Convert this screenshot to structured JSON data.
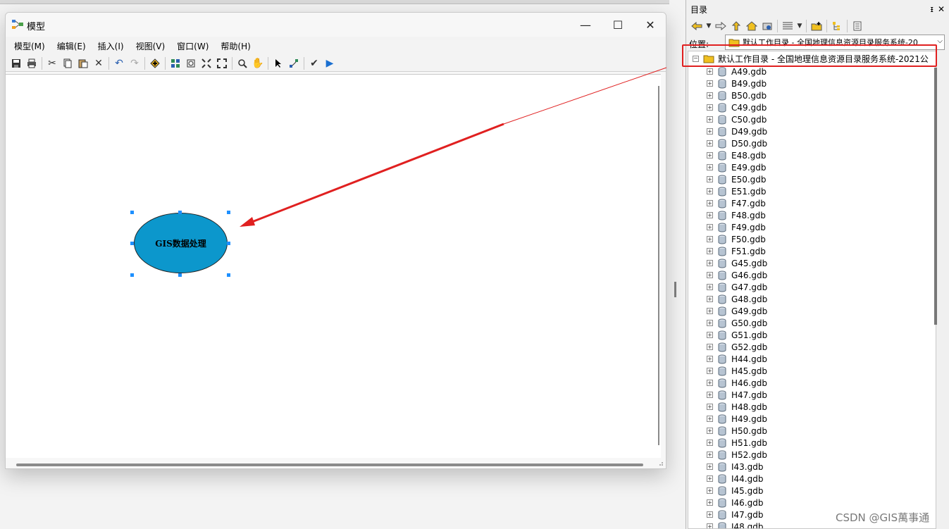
{
  "model_window": {
    "title": "模型",
    "menus": [
      "模型(M)",
      "编辑(E)",
      "插入(I)",
      "视图(V)",
      "窗口(W)",
      "帮助(H)"
    ],
    "minimize": "—",
    "maximize": "☐",
    "close": "✕",
    "process_label": "GIS数据处理",
    "process_color": "#0c97cc"
  },
  "catalog": {
    "title": "目录",
    "pin": "ᵻ",
    "close": "✕",
    "location_label": "位置:",
    "location_value": "默认工作目录 - 全国地理信息资源目录服务系统-20",
    "root_label": "默认工作目录 - 全国地理信息资源目录服务系统-2021公",
    "items": [
      "A49.gdb",
      "B49.gdb",
      "B50.gdb",
      "C49.gdb",
      "C50.gdb",
      "D49.gdb",
      "D50.gdb",
      "E48.gdb",
      "E49.gdb",
      "E50.gdb",
      "E51.gdb",
      "F47.gdb",
      "F48.gdb",
      "F49.gdb",
      "F50.gdb",
      "F51.gdb",
      "G45.gdb",
      "G46.gdb",
      "G47.gdb",
      "G48.gdb",
      "G49.gdb",
      "G50.gdb",
      "G51.gdb",
      "G52.gdb",
      "H44.gdb",
      "H45.gdb",
      "H46.gdb",
      "H47.gdb",
      "H48.gdb",
      "H49.gdb",
      "H50.gdb",
      "H51.gdb",
      "H52.gdb",
      "I43.gdb",
      "I44.gdb",
      "I45.gdb",
      "I46.gdb",
      "I47.gdb",
      "I48.gdb"
    ]
  },
  "watermark": "CSDN @GIS萬事通",
  "annotation_color": "#e02020"
}
